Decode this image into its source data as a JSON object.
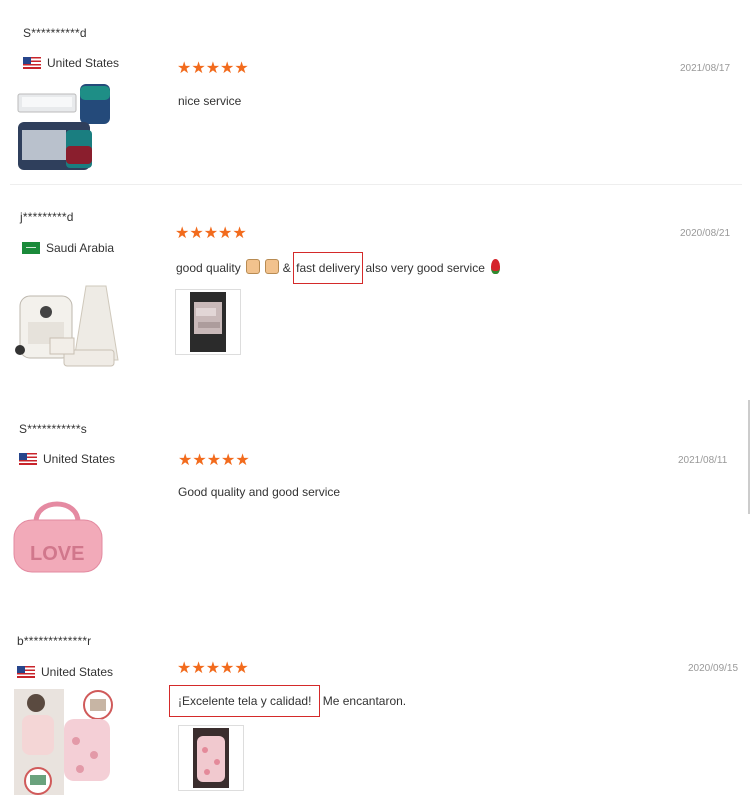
{
  "reviews": [
    {
      "user": "S**********d",
      "country": "United States",
      "flag": "us",
      "date": "2021/08/17",
      "text_before": "nice service",
      "text_highlight": "",
      "text_after": "",
      "rating": 5
    },
    {
      "user": "j*********d",
      "country": "Saudi Arabia",
      "flag": "sa",
      "date": "2020/08/21",
      "text_before": "good quality",
      "text_mid": "&",
      "text_highlight": "fast delivery",
      "text_after": "also very good service",
      "rating": 5
    },
    {
      "user": "S***********s",
      "country": "United States",
      "flag": "us",
      "date": "2021/08/11",
      "text_before": "Good quality and good service",
      "text_highlight": "",
      "text_after": "",
      "rating": 5
    },
    {
      "user": "b*************r",
      "country": "United States",
      "flag": "us",
      "date": "2020/09/15",
      "text_before": "",
      "text_highlight": "¡Excelente tela y calidad!",
      "text_after": "Me encantaron.",
      "rating": 5
    }
  ],
  "star_glyph": "★★★★★",
  "colors": {
    "star": "#f26b1d",
    "highlight_box": "#d42a2a",
    "date": "#999999"
  },
  "icons": {
    "flag_us": "us-flag-icon",
    "flag_sa": "sa-flag-icon",
    "star": "star-icon"
  }
}
